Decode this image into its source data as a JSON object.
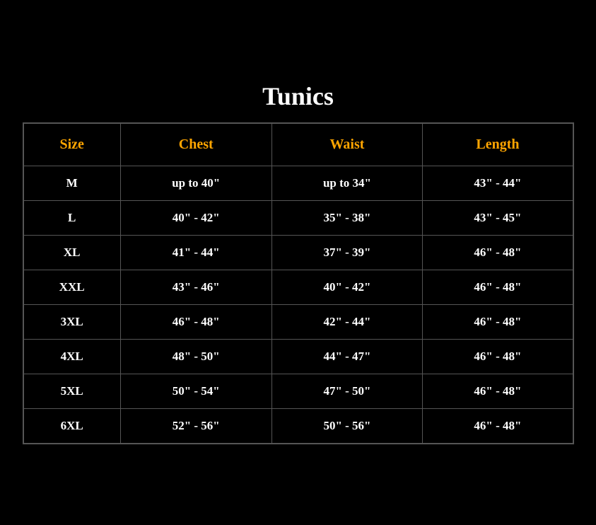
{
  "title": "Tunics",
  "table": {
    "headers": [
      "Size",
      "Chest",
      "Waist",
      "Length"
    ],
    "rows": [
      {
        "size": "M",
        "chest": "up to 40\"",
        "waist": "up to 34\"",
        "length": "43\" - 44\""
      },
      {
        "size": "L",
        "chest": "40\" - 42\"",
        "waist": "35\" - 38\"",
        "length": "43\" - 45\""
      },
      {
        "size": "XL",
        "chest": "41\" - 44\"",
        "waist": "37\" - 39\"",
        "length": "46\" - 48\""
      },
      {
        "size": "XXL",
        "chest": "43\" - 46\"",
        "waist": "40\" - 42\"",
        "length": "46\" - 48\""
      },
      {
        "size": "3XL",
        "chest": "46\" - 48\"",
        "waist": "42\" - 44\"",
        "length": "46\" - 48\""
      },
      {
        "size": "4XL",
        "chest": "48\" - 50\"",
        "waist": "44\" - 47\"",
        "length": "46\" - 48\""
      },
      {
        "size": "5XL",
        "chest": "50\" - 54\"",
        "waist": "47\" - 50\"",
        "length": "46\" - 48\""
      },
      {
        "size": "6XL",
        "chest": "52\" - 56\"",
        "waist": "50\" - 56\"",
        "length": "46\" - 48\""
      }
    ]
  }
}
